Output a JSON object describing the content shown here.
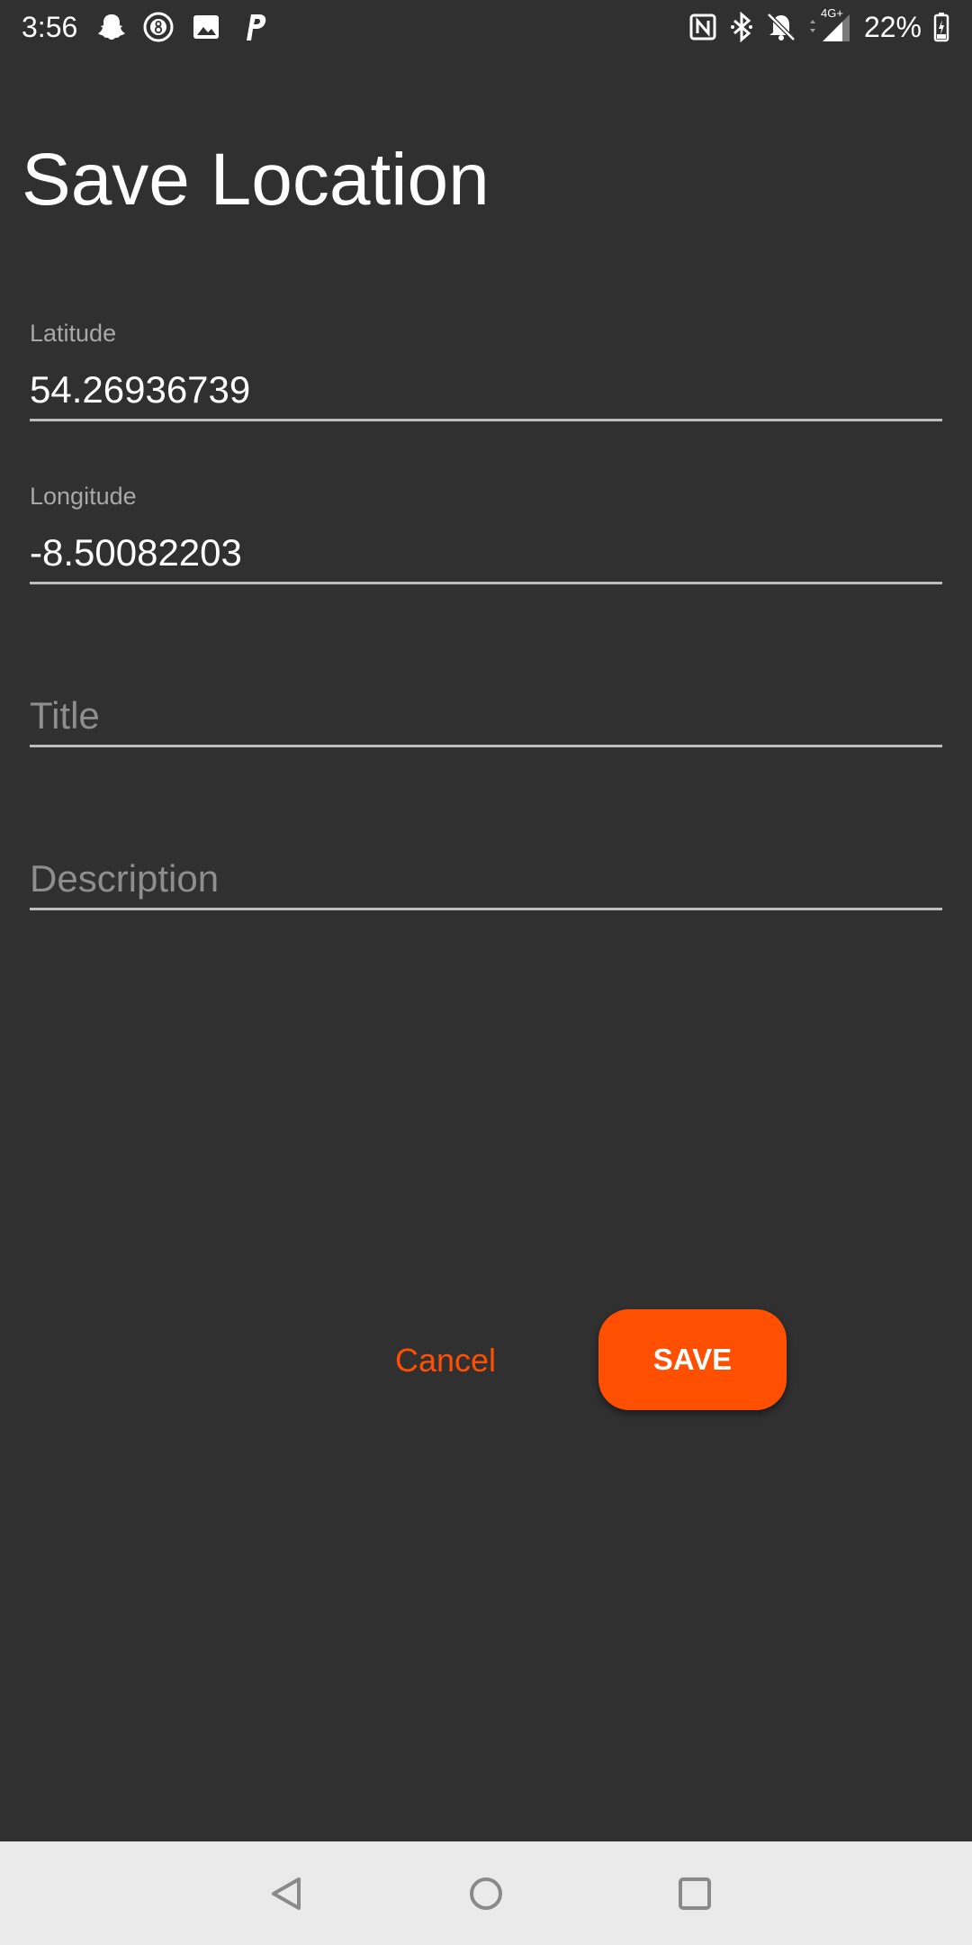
{
  "status_bar": {
    "time": "3:56",
    "notification_icons": [
      "snapchat-icon",
      "eight-ball-icon",
      "image-icon",
      "paypal-icon"
    ],
    "system_icons": [
      "nfc-icon",
      "bluetooth-icon",
      "bell-off-icon",
      "network-4g-icon",
      "signal-icon",
      "battery-icon"
    ],
    "network_label": "4G+",
    "battery": "22%"
  },
  "page": {
    "title": "Save Location"
  },
  "form": {
    "latitude": {
      "label": "Latitude",
      "value": "54.26936739"
    },
    "longitude": {
      "label": "Longitude",
      "value": "-8.50082203"
    },
    "title_field": {
      "placeholder": "Title",
      "value": ""
    },
    "description_field": {
      "placeholder": "Description",
      "value": ""
    }
  },
  "actions": {
    "cancel_label": "Cancel",
    "save_label": "SAVE"
  },
  "navigation": {
    "buttons": [
      "back-icon",
      "home-icon",
      "recents-icon"
    ]
  },
  "colors": {
    "background": "#303030",
    "accent": "#ff4f00",
    "text_primary": "#ffffff",
    "text_hint": "#a8a8a8",
    "nav_bar": "#eaeaea"
  }
}
